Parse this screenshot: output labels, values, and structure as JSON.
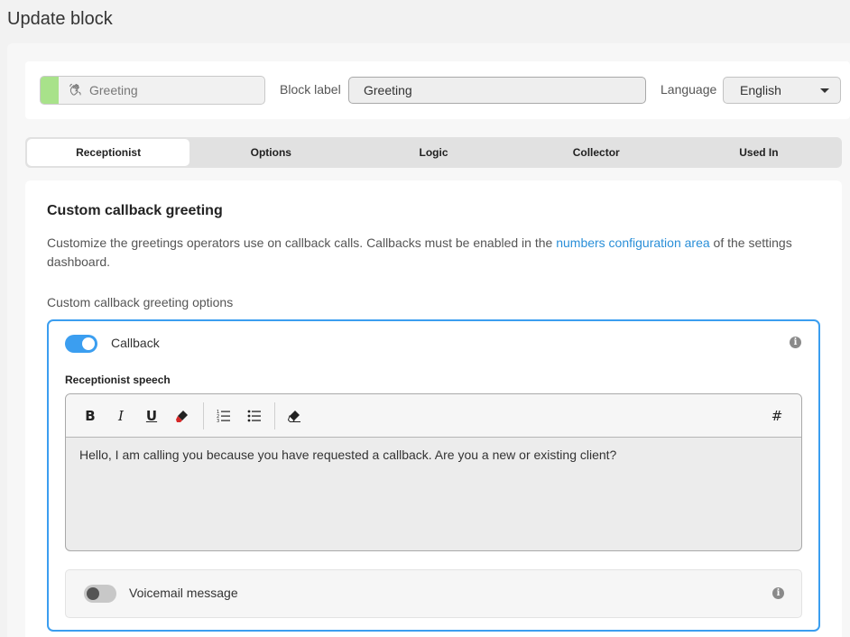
{
  "page": {
    "title": "Update block"
  },
  "header": {
    "block_type": "Greeting",
    "block_label_caption": "Block label",
    "block_label_value": "Greeting",
    "language_caption": "Language",
    "language_value": "English",
    "accent_color": "#a8e28a"
  },
  "tabs": [
    {
      "label": "Receptionist",
      "active": true
    },
    {
      "label": "Options",
      "active": false
    },
    {
      "label": "Logic",
      "active": false
    },
    {
      "label": "Collector",
      "active": false
    },
    {
      "label": "Used In",
      "active": false
    }
  ],
  "section": {
    "title": "Custom callback greeting",
    "desc_before": "Customize the greetings operators use on callback calls. Callbacks must be enabled in the ",
    "desc_link": "numbers configuration area",
    "desc_after": " of the settings dashboard.",
    "options_label": "Custom callback greeting options"
  },
  "callback": {
    "label": "Callback",
    "enabled": true,
    "speech_label": "Receptionist speech",
    "speech_text": "Hello, I am calling you because you have requested a callback. Are you a new or existing client?"
  },
  "toolbar": {
    "bold": "B",
    "italic": "I",
    "underline": "U",
    "variable": "#"
  },
  "voicemail": {
    "label": "Voicemail message",
    "enabled": false
  },
  "colors": {
    "primary": "#3b9ef0",
    "link": "#2a8fd8"
  }
}
